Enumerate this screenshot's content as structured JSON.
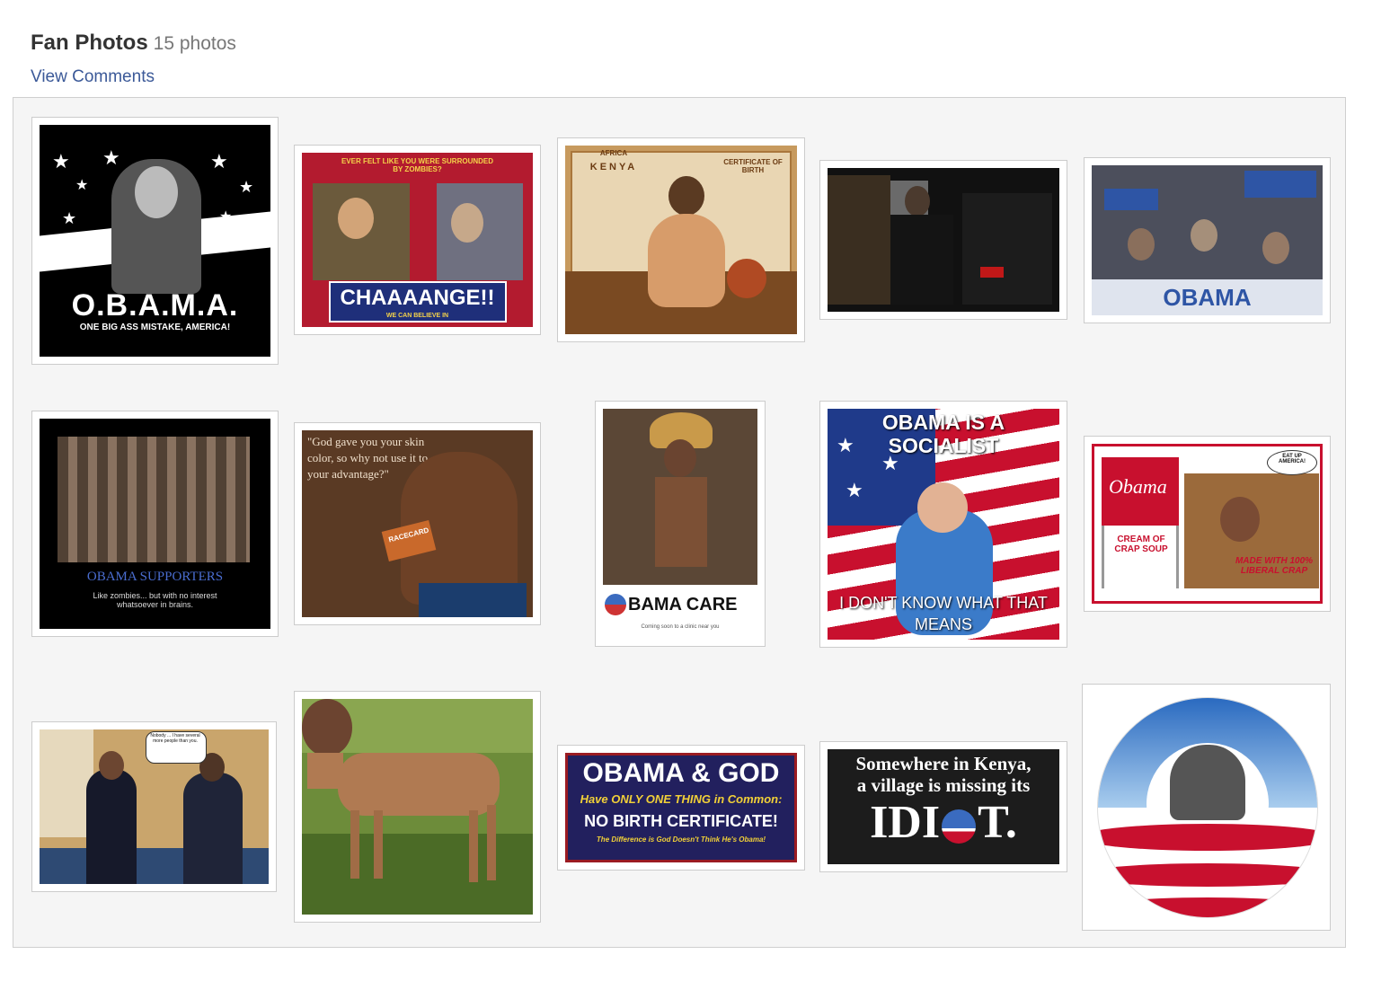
{
  "header": {
    "title": "Fan Photos",
    "count": "15 photos",
    "view_comments": "View Comments"
  },
  "photos": {
    "p1": {
      "big": "O.B.A.M.A.",
      "small": "ONE BIG ASS MISTAKE, AMERICA!"
    },
    "p2": {
      "top": "EVER FELT LIKE YOU WERE SURROUNDED BY ZOMBIES?",
      "banner": "CHAAAANGE!!",
      "sub": "WE CAN BELIEVE IN"
    },
    "p3": {
      "top": "AFRICA",
      "kenya": "KENYA",
      "cert": "CERTIFICATE OF BIRTH"
    },
    "p5": {
      "sign": "OBAMA"
    },
    "p6": {
      "head": "OBAMA SUPPORTERS",
      "sub": "Like zombies... but with no interest whatsoever in brains."
    },
    "p7": {
      "quote": "\"God gave you your skin color, so why not use it to your advantage?\"",
      "card": "RACECARD"
    },
    "p8": {
      "label": "BAMA CARE",
      "sub": "Coming soon to a clinic near you"
    },
    "p9": {
      "top": "OBAMA IS A SOCIALIST",
      "bottom": "I DON'T KNOW WHAT THAT MEANS"
    },
    "p10": {
      "can": "Obama",
      "soup": "CREAM OF CRAP SOUP",
      "made": "MADE WITH 100% LIBERAL CRAP",
      "bubble": "EAT UP AMERICA!"
    },
    "p11": {
      "bubble": "Nobody ... I have several more people than you."
    },
    "p13": {
      "l1": "OBAMA & GOD",
      "l2": "Have ONLY ONE THING in Common:",
      "l3": "NO BIRTH CERTIFICATE!",
      "l4": "The Difference is God Doesn't Think He's Obama!"
    },
    "p14": {
      "l1": "Somewhere in Kenya,",
      "l2": "a village is missing its",
      "l3": "IDI",
      "l4": "T."
    }
  },
  "colors": {
    "link": "#3b5998",
    "panel_bg": "#f5f5f5",
    "panel_border": "#cfcfcf"
  }
}
